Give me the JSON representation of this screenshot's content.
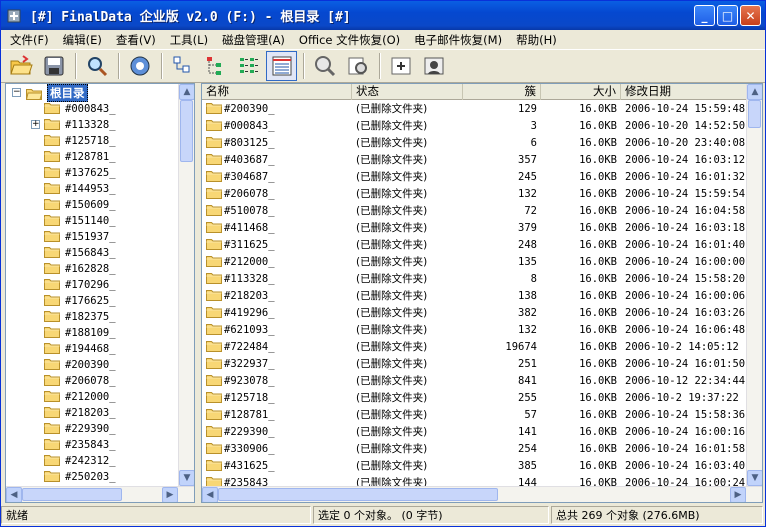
{
  "window": {
    "title": "[#] FinalData 企业版 v2.0 (F:) - 根目录 [#]",
    "buttons": {
      "minimize": "_",
      "maximize": "□",
      "close": "✕"
    }
  },
  "menu": [
    {
      "label": "文件(F)"
    },
    {
      "label": "编辑(E)"
    },
    {
      "label": "查看(V)"
    },
    {
      "label": "工具(L)"
    },
    {
      "label": "磁盘管理(A)"
    },
    {
      "label": "Office 文件恢复(O)"
    },
    {
      "label": "电子邮件恢复(M)"
    },
    {
      "label": "帮助(H)"
    }
  ],
  "toolbar": {
    "buttons": [
      "open-folder-icon",
      "save-disk-icon",
      "search-icon",
      "gear-icon",
      "small-icons-view-icon",
      "tree-view-icon",
      "list-view-icon",
      "details-view-icon",
      "find-icon",
      "properties-icon",
      "new-window-icon",
      "preview-icon"
    ]
  },
  "tree": {
    "root_label": "根目录",
    "items": [
      "#000843_",
      "#113328_",
      "#125718_",
      "#128781_",
      "#137625_",
      "#144953_",
      "#150609_",
      "#151140_",
      "#151937_",
      "#156843_",
      "#162828_",
      "#170296_",
      "#176625_",
      "#182375_",
      "#188109_",
      "#194468_",
      "#200390_",
      "#206078_",
      "#212000_",
      "#218203_",
      "#229390_",
      "#235843_",
      "#242312_",
      "#250203_"
    ]
  },
  "list": {
    "columns": {
      "name": "名称",
      "status": "状态",
      "clusters": "簇",
      "size": "大小",
      "date": "修改日期"
    },
    "rows": [
      {
        "name": "#200390_",
        "status": "(已删除文件夹)",
        "clusters": "129",
        "size": "16.0KB",
        "date": "2006-10-24 15:59:48"
      },
      {
        "name": "#000843_",
        "status": "(已删除文件夹)",
        "clusters": "3",
        "size": "16.0KB",
        "date": "2006-10-20 14:52:50"
      },
      {
        "name": "#803125_",
        "status": "(已删除文件夹)",
        "clusters": "6",
        "size": "16.0KB",
        "date": "2006-10-20 23:40:08"
      },
      {
        "name": "#403687_",
        "status": "(已删除文件夹)",
        "clusters": "357",
        "size": "16.0KB",
        "date": "2006-10-24 16:03:12"
      },
      {
        "name": "#304687_",
        "status": "(已删除文件夹)",
        "clusters": "245",
        "size": "16.0KB",
        "date": "2006-10-24 16:01:32"
      },
      {
        "name": "#206078_",
        "status": "(已删除文件夹)",
        "clusters": "132",
        "size": "16.0KB",
        "date": "2006-10-24 15:59:54"
      },
      {
        "name": "#510078_",
        "status": "(已删除文件夹)",
        "clusters": "72",
        "size": "16.0KB",
        "date": "2006-10-24 16:04:58"
      },
      {
        "name": "#411468_",
        "status": "(已删除文件夹)",
        "clusters": "379",
        "size": "16.0KB",
        "date": "2006-10-24 16:03:18"
      },
      {
        "name": "#311625_",
        "status": "(已删除文件夹)",
        "clusters": "248",
        "size": "16.0KB",
        "date": "2006-10-24 16:01:40"
      },
      {
        "name": "#212000_",
        "status": "(已删除文件夹)",
        "clusters": "135",
        "size": "16.0KB",
        "date": "2006-10-24 16:00:00"
      },
      {
        "name": "#113328_",
        "status": "(已删除文件夹)",
        "clusters": "8",
        "size": "16.0KB",
        "date": "2006-10-24 15:58:20"
      },
      {
        "name": "#218203_",
        "status": "(已删除文件夹)",
        "clusters": "138",
        "size": "16.0KB",
        "date": "2006-10-24 16:00:06"
      },
      {
        "name": "#419296_",
        "status": "(已删除文件夹)",
        "clusters": "382",
        "size": "16.0KB",
        "date": "2006-10-24 16:03:26"
      },
      {
        "name": "#621093_",
        "status": "(已删除文件夹)",
        "clusters": "132",
        "size": "16.0KB",
        "date": "2006-10-24 16:06:48"
      },
      {
        "name": "#722484_",
        "status": "(已删除文件夹)",
        "clusters": "19674",
        "size": "16.0KB",
        "date": "2006-10-2 14:05:12"
      },
      {
        "name": "#322937_",
        "status": "(已删除文件夹)",
        "clusters": "251",
        "size": "16.0KB",
        "date": "2006-10-24 16:01:50"
      },
      {
        "name": "#923078_",
        "status": "(已删除文件夹)",
        "clusters": "841",
        "size": "16.0KB",
        "date": "2006-10-12 22:34:44"
      },
      {
        "name": "#125718_",
        "status": "(已删除文件夹)",
        "clusters": "255",
        "size": "16.0KB",
        "date": "2006-10-2 19:37:22"
      },
      {
        "name": "#128781_",
        "status": "(已删除文件夹)",
        "clusters": "57",
        "size": "16.0KB",
        "date": "2006-10-24 15:58:36"
      },
      {
        "name": "#229390_",
        "status": "(已删除文件夹)",
        "clusters": "141",
        "size": "16.0KB",
        "date": "2006-10-24 16:00:16"
      },
      {
        "name": "#330906_",
        "status": "(已删除文件夹)",
        "clusters": "254",
        "size": "16.0KB",
        "date": "2006-10-24 16:01:58"
      },
      {
        "name": "#431625_",
        "status": "(已删除文件夹)",
        "clusters": "385",
        "size": "16.0KB",
        "date": "2006-10-24 16:03:40"
      },
      {
        "name": "#235843_",
        "status": "(已删除文件夹)",
        "clusters": "144",
        "size": "16.0KB",
        "date": "2006-10-24 16:00:24"
      }
    ]
  },
  "status": {
    "left": "就绪",
    "middle": "选定 0 个对象。 (0 字节)",
    "right": "总共 269 个对象 (276.6MB)"
  },
  "colors": {
    "titlebar": "#0548d0",
    "selection": "#316ac5",
    "folder": "#f8d775"
  }
}
